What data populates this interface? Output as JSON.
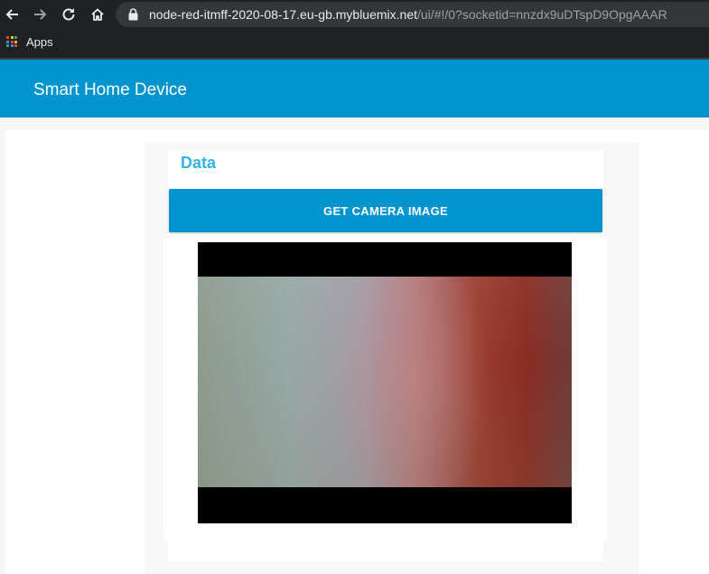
{
  "browser": {
    "url_host": "node-red-itmff-2020-08-17.eu-gb.mybluemix.net",
    "url_path": "/ui/#!/0?socketid=nnzdx9uDTspD9OpgAAAR",
    "bookmarks": [
      {
        "label": "Apps",
        "icon": "apps-grid-icon"
      }
    ],
    "icons": [
      "back-arrow-icon",
      "forward-arrow-icon",
      "reload-icon",
      "home-icon",
      "lock-icon"
    ]
  },
  "header": {
    "title": "Smart Home Device"
  },
  "group": {
    "title": "Data",
    "button_label": "GET CAMERA IMAGE"
  },
  "colors": {
    "accent": "#0094ce",
    "group_title": "#33b3e8"
  }
}
